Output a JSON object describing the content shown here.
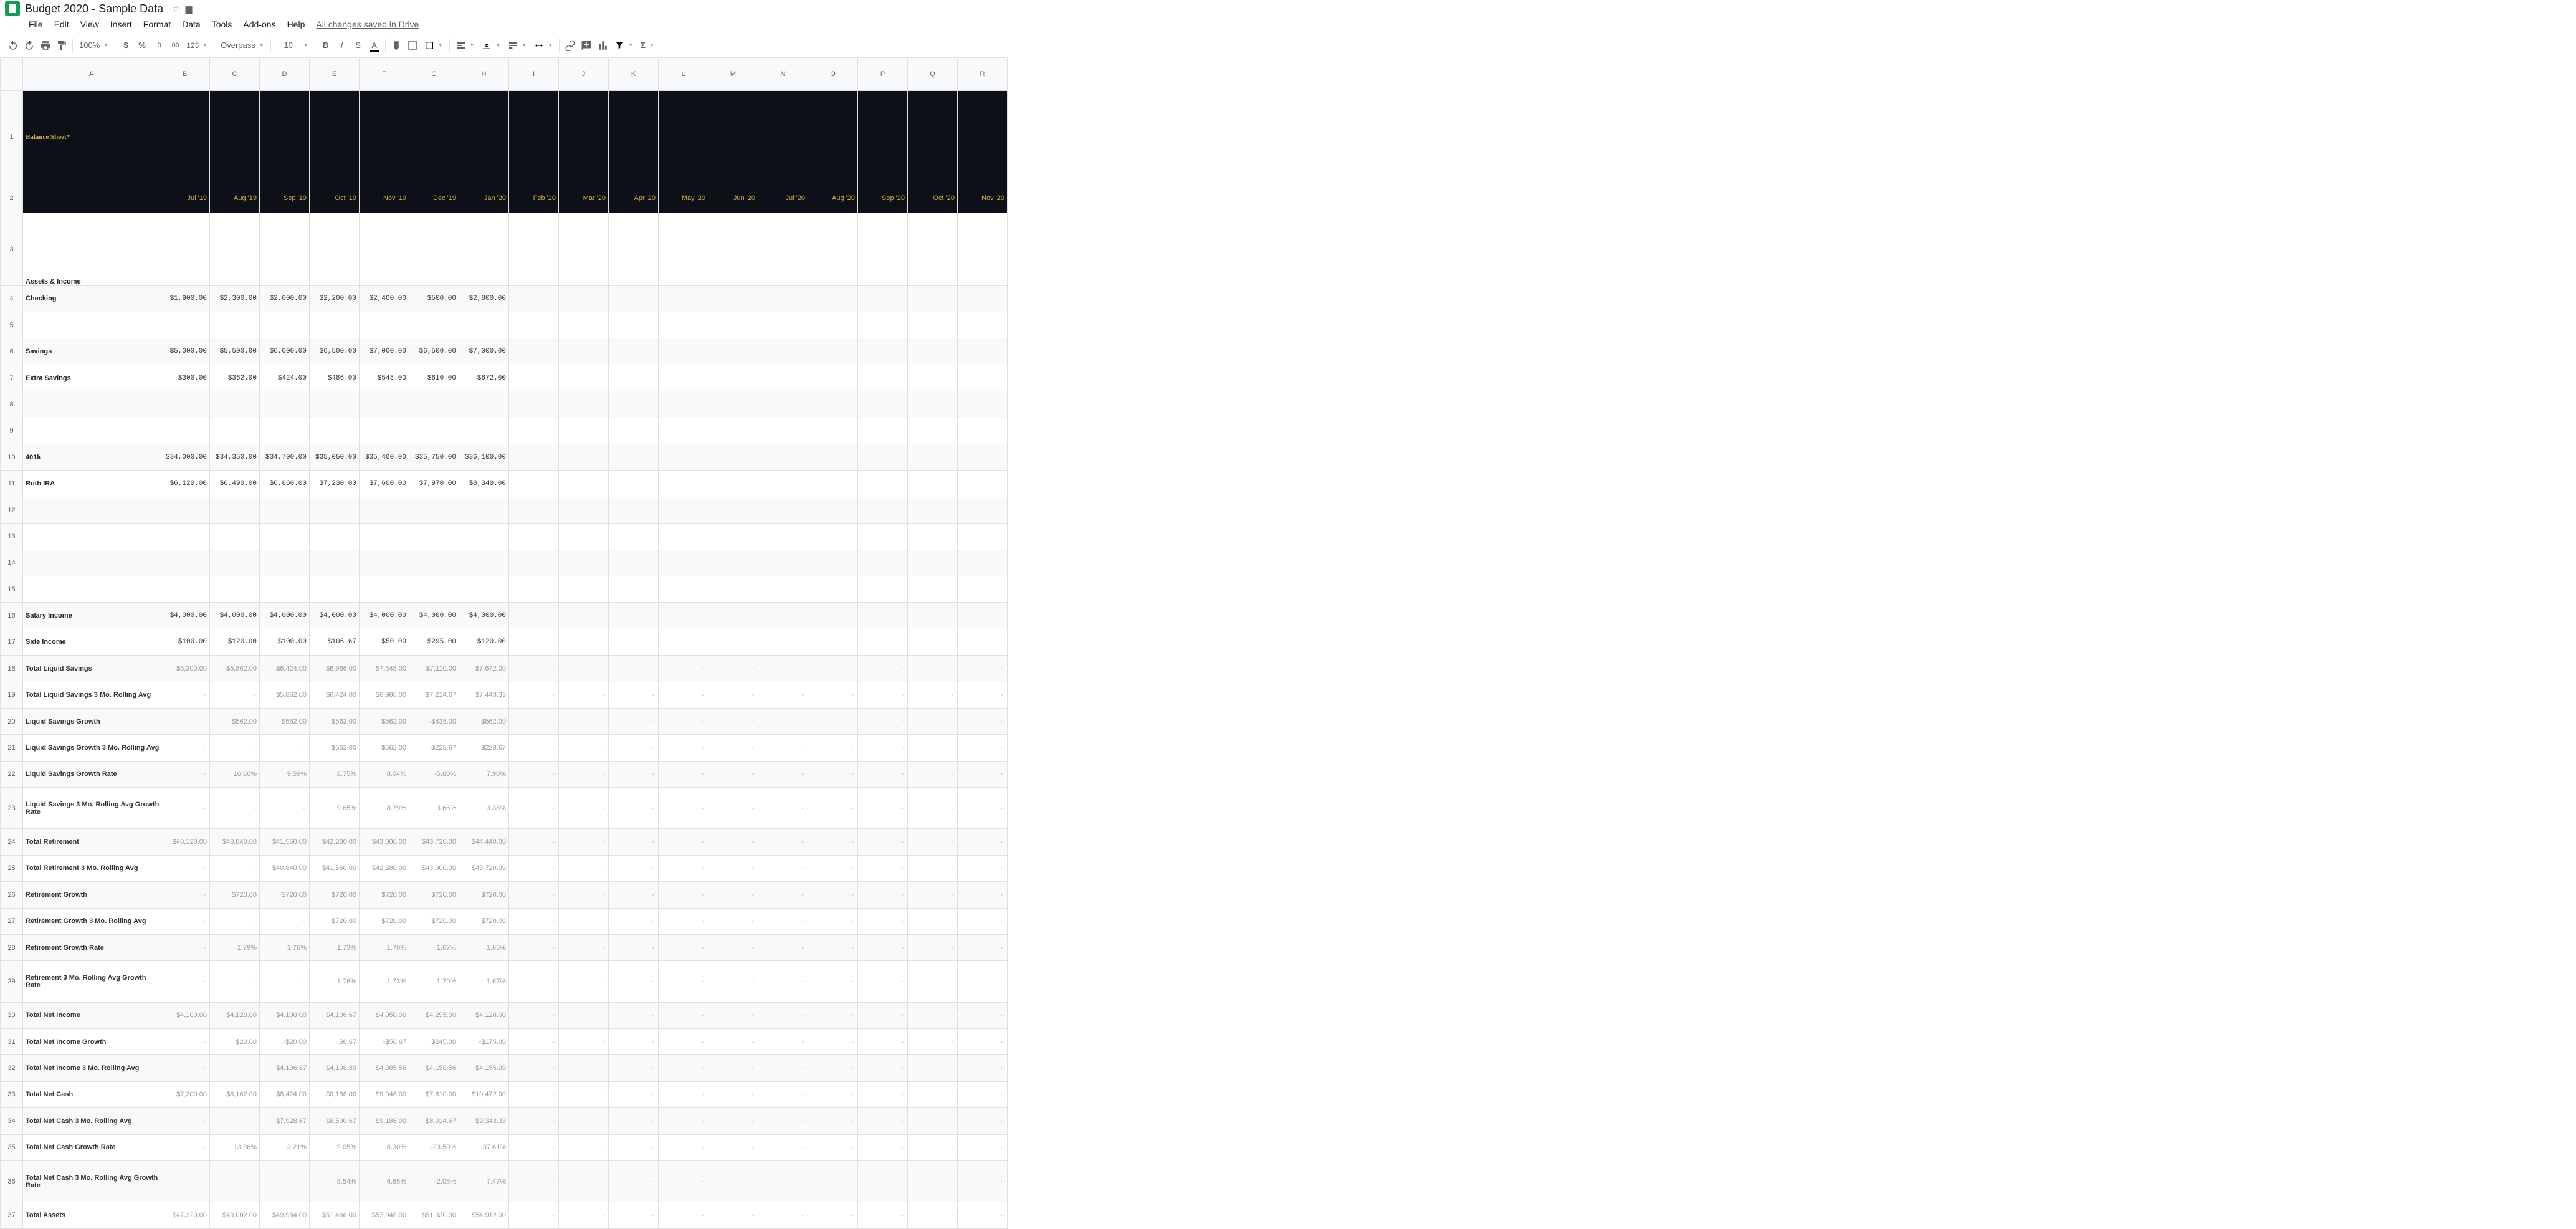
{
  "doc": {
    "title": "Budget 2020 - Sample Data"
  },
  "menu": {
    "file": "File",
    "edit": "Edit",
    "view": "View",
    "insert": "Insert",
    "format": "Format",
    "data": "Data",
    "tools": "Tools",
    "addons": "Add-ons",
    "help": "Help",
    "saveStatus": "All changes saved in Drive"
  },
  "toolbar": {
    "zoom": "100%",
    "fontName": "Overpass",
    "fontSize": "10"
  },
  "columns": [
    "A",
    "B",
    "C",
    "D",
    "E",
    "F",
    "G",
    "H",
    "I",
    "J",
    "K",
    "L",
    "M",
    "N",
    "O",
    "P",
    "Q",
    "R"
  ],
  "sheet": {
    "title": "Balance Sheet*",
    "months": [
      "Jul '19",
      "Aug '19",
      "Sep '19",
      "Oct '19",
      "Nov '19",
      "Dec '19",
      "Jan '20",
      "Feb '20",
      "Mar '20",
      "Apr '20",
      "May '20",
      "Jun '20",
      "Jul '20",
      "Aug '20",
      "Sep '20",
      "Oct '20",
      "Nov '20"
    ],
    "sectionTitle": "Assets & Income",
    "rows": [
      {
        "type": "data",
        "style": "mono",
        "label": "Checking",
        "values": [
          "$1,900.00",
          "$2,300.00",
          "$2,000.00",
          "$2,200.00",
          "$2,400.00",
          "$500.00",
          "$2,800.00"
        ]
      },
      {
        "type": "blank"
      },
      {
        "type": "data",
        "style": "mono",
        "label": "Savings",
        "values": [
          "$5,000.00",
          "$5,500.00",
          "$6,000.00",
          "$6,500.00",
          "$7,000.00",
          "$6,500.00",
          "$7,000.00"
        ]
      },
      {
        "type": "data",
        "style": "mono",
        "label": "Extra Savings",
        "values": [
          "$300.00",
          "$362.00",
          "$424.00",
          "$486.00",
          "$548.00",
          "$610.00",
          "$672.00"
        ]
      },
      {
        "type": "blank"
      },
      {
        "type": "blank"
      },
      {
        "type": "data",
        "style": "mono",
        "label": "401k",
        "values": [
          "$34,000.00",
          "$34,350.00",
          "$34,700.00",
          "$35,050.00",
          "$35,400.00",
          "$35,750.00",
          "$36,100.00"
        ]
      },
      {
        "type": "data",
        "style": "mono",
        "label": "Roth IRA",
        "values": [
          "$6,120.00",
          "$6,490.00",
          "$6,860.00",
          "$7,230.00",
          "$7,600.00",
          "$7,970.00",
          "$8,340.00"
        ]
      },
      {
        "type": "blank"
      },
      {
        "type": "blank"
      },
      {
        "type": "blank"
      },
      {
        "type": "blank"
      },
      {
        "type": "data",
        "style": "mono",
        "label": "Salary Income",
        "values": [
          "$4,000.00",
          "$4,000.00",
          "$4,000.00",
          "$4,000.00",
          "$4,000.00",
          "$4,000.00",
          "$4,000.00"
        ]
      },
      {
        "type": "data",
        "style": "mono",
        "label": "Side Income",
        "values": [
          "$100.00",
          "$120.00",
          "$100.00",
          "$106.67",
          "$50.00",
          "$295.00",
          "$120.00"
        ]
      },
      {
        "type": "calc",
        "label": "Total Liquid Savings",
        "values": [
          "$5,300.00",
          "$5,862.00",
          "$6,424.00",
          "$6,986.00",
          "$7,548.00",
          "$7,110.00",
          "$7,672.00"
        ],
        "trail": true
      },
      {
        "type": "calc",
        "label": "Total Liquid Savings 3 Mo. Rolling Avg",
        "values": [
          "-",
          "-",
          "$5,862.00",
          "$6,424.00",
          "$6,986.00",
          "$7,214.67",
          "$7,443.33"
        ],
        "trail": true
      },
      {
        "type": "calc",
        "label": "Liquid Savings Growth",
        "values": [
          "-",
          "$562.00",
          "$562.00",
          "$562.00",
          "$562.00",
          "-$438.00",
          "$562.00"
        ],
        "trail": true
      },
      {
        "type": "calc",
        "label": "Liquid Savings Growth 3 Mo. Rolling Avg",
        "values": [
          "-",
          "-",
          "-",
          "$562.00",
          "$562.00",
          "$228.67",
          "$228.67"
        ],
        "trail": true
      },
      {
        "type": "calc",
        "label": "Liquid Savings Growth Rate",
        "values": [
          "-",
          "10.60%",
          "9.59%",
          "8.75%",
          "8.04%",
          "-5.80%",
          "7.90%"
        ],
        "trail": true
      },
      {
        "type": "calc",
        "label": "Liquid Savings 3 Mo. Rolling Avg Growth Rate",
        "values": [
          "-",
          "-",
          "-",
          "9.65%",
          "8.79%",
          "3.66%",
          "3.38%"
        ],
        "trail": true
      },
      {
        "type": "calc",
        "label": "Total Retirement",
        "values": [
          "$40,120.00",
          "$40,840.00",
          "$41,560.00",
          "$42,280.00",
          "$43,000.00",
          "$43,720.00",
          "$44,440.00"
        ],
        "trail": true
      },
      {
        "type": "calc",
        "label": "Total Retirement 3 Mo. Rolling Avg",
        "values": [
          "-",
          "-",
          "$40,840.00",
          "$41,560.00",
          "$42,280.00",
          "$43,000.00",
          "$43,720.00"
        ],
        "trail": true
      },
      {
        "type": "calc",
        "label": "Retirement Growth",
        "values": [
          "-",
          "$720.00",
          "$720.00",
          "$720.00",
          "$720.00",
          "$720.00",
          "$720.00"
        ],
        "trail": true
      },
      {
        "type": "calc",
        "label": "Retirement Growth 3 Mo. Rolling Avg",
        "values": [
          "-",
          "-",
          "-",
          "$720.00",
          "$720.00",
          "$720.00",
          "$720.00"
        ],
        "trail": true
      },
      {
        "type": "calc",
        "label": "Retirement Growth Rate",
        "values": [
          "-",
          "1.79%",
          "1.76%",
          "1.73%",
          "1.70%",
          "1.67%",
          "1.65%"
        ],
        "trail": true
      },
      {
        "type": "calc",
        "label": "Retirement 3 Mo. Rolling Avg Growth Rate",
        "values": [
          "-",
          "-",
          "-",
          "1.76%",
          "1.73%",
          "1.70%",
          "1.67%"
        ],
        "trail": true
      },
      {
        "type": "calc",
        "label": "Total Net Income",
        "values": [
          "$4,100.00",
          "$4,120.00",
          "$4,100.00",
          "$4,106.67",
          "$4,050.00",
          "$4,295.00",
          "$4,120.00"
        ],
        "trail": true
      },
      {
        "type": "calc",
        "label": "Total Net Income Growth",
        "values": [
          "-",
          "$20.00",
          "-$20.00",
          "$6.67",
          "-$56.67",
          "$245.00",
          "-$175.00"
        ],
        "trail": true
      },
      {
        "type": "calc",
        "label": "Total Net Income 3 Mo. Rolling Avg",
        "values": [
          "-",
          "-",
          "$4,106.67",
          "$4,108.89",
          "$4,085.56",
          "$4,150.56",
          "$4,155.00"
        ],
        "trail": true
      },
      {
        "type": "calc",
        "label": "Total Net Cash",
        "values": [
          "$7,200.00",
          "$8,162.00",
          "$8,424.00",
          "$9,186.00",
          "$9,948.00",
          "$7,610.00",
          "$10,472.00"
        ],
        "trail": true
      },
      {
        "type": "calc",
        "label": "Total Net Cash 3 Mo. Rolling Avg",
        "values": [
          "-",
          "-",
          "$7,928.67",
          "$8,590.67",
          "$9,186.00",
          "$8,914.67",
          "$9,343.33"
        ],
        "trail": true
      },
      {
        "type": "calc",
        "label": "Total Net Cash Growth Rate",
        "values": [
          "-",
          "13.36%",
          "3.21%",
          "9.05%",
          "8.30%",
          "-23.50%",
          "37.61%"
        ],
        "trail": true
      },
      {
        "type": "calc",
        "label": "Total Net Cash 3 Mo. Rolling Avg Growth Rate",
        "values": [
          "-",
          "-",
          "-",
          "8.54%",
          "6.85%",
          "-2.05%",
          "7.47%"
        ],
        "trail": true
      },
      {
        "type": "calc",
        "label": "Total Assets",
        "values": [
          "$47,320.00",
          "$49,002.00",
          "$49,984.00",
          "$51,466.00",
          "$52,948.00",
          "$51,330.00",
          "$54,912.00"
        ],
        "trail": true
      }
    ]
  }
}
